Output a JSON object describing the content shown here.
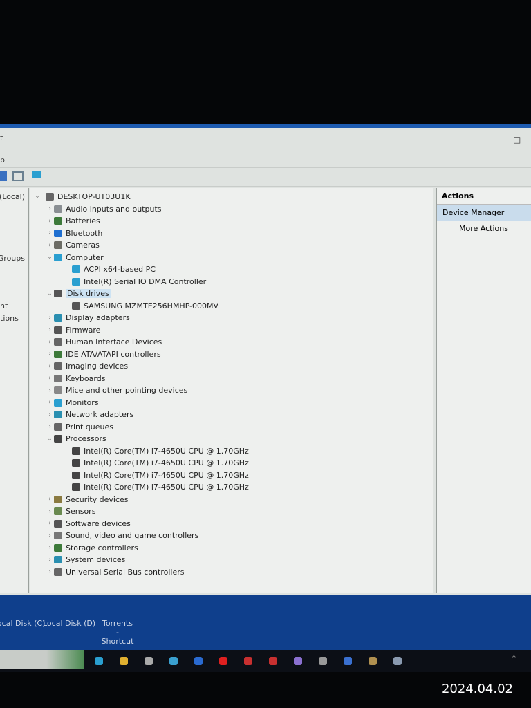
{
  "window": {
    "title_fragment": "t",
    "menu_fragment": "p",
    "max_icon": "maximize-icon",
    "min_icon": "minimize-icon"
  },
  "left_pane": [
    "(Local)",
    "Groups",
    "nt",
    "tions"
  ],
  "tree": {
    "root": "DESKTOP-UT03U1K",
    "rows": [
      {
        "label": "Audio inputs and outputs",
        "level": 1,
        "expanded": false,
        "icon": "speaker-icon",
        "color": "#8a8f93"
      },
      {
        "label": "Batteries",
        "level": 1,
        "expanded": false,
        "icon": "battery-icon",
        "color": "#3d7a3a"
      },
      {
        "label": "Bluetooth",
        "level": 1,
        "expanded": false,
        "icon": "bluetooth-icon",
        "color": "#1f6fd0"
      },
      {
        "label": "Cameras",
        "level": 1,
        "expanded": false,
        "icon": "camera-icon",
        "color": "#6d6d66"
      },
      {
        "label": "Computer",
        "level": 1,
        "expanded": true,
        "icon": "monitor-icon",
        "color": "#2a9fd0"
      },
      {
        "label": "ACPI x64-based PC",
        "level": 2,
        "icon": "monitor-icon",
        "color": "#2a9fd0"
      },
      {
        "label": "Intel(R) Serial IO DMA Controller",
        "level": 2,
        "icon": "monitor-icon",
        "color": "#2a9fd0"
      },
      {
        "label": "Disk drives",
        "level": 1,
        "expanded": true,
        "selected": true,
        "icon": "disk-icon",
        "color": "#555"
      },
      {
        "label": "SAMSUNG MZMTE256HMHP-000MV",
        "level": 2,
        "icon": "disk-icon",
        "color": "#555"
      },
      {
        "label": "Display adapters",
        "level": 1,
        "expanded": false,
        "icon": "display-icon",
        "color": "#2a8fb0"
      },
      {
        "label": "Firmware",
        "level": 1,
        "expanded": false,
        "icon": "firmware-icon",
        "color": "#555"
      },
      {
        "label": "Human Interface Devices",
        "level": 1,
        "expanded": false,
        "icon": "hid-icon",
        "color": "#666"
      },
      {
        "label": "IDE ATA/ATAPI controllers",
        "level": 1,
        "expanded": false,
        "icon": "controller-icon",
        "color": "#3d7a3a"
      },
      {
        "label": "Imaging devices",
        "level": 1,
        "expanded": false,
        "icon": "scanner-icon",
        "color": "#666"
      },
      {
        "label": "Keyboards",
        "level": 1,
        "expanded": false,
        "icon": "keyboard-icon",
        "color": "#777"
      },
      {
        "label": "Mice and other pointing devices",
        "level": 1,
        "expanded": false,
        "icon": "mouse-icon",
        "color": "#888"
      },
      {
        "label": "Monitors",
        "level": 1,
        "expanded": false,
        "icon": "monitor-icon",
        "color": "#2a9fd0"
      },
      {
        "label": "Network adapters",
        "level": 1,
        "expanded": false,
        "icon": "network-icon",
        "color": "#2a8fb0"
      },
      {
        "label": "Print queues",
        "level": 1,
        "expanded": false,
        "icon": "printer-icon",
        "color": "#666"
      },
      {
        "label": "Processors",
        "level": 1,
        "expanded": true,
        "icon": "cpu-icon",
        "color": "#444"
      },
      {
        "label": "Intel(R) Core(TM) i7-4650U CPU @ 1.70GHz",
        "level": 2,
        "icon": "cpu-icon",
        "color": "#444"
      },
      {
        "label": "Intel(R) Core(TM) i7-4650U CPU @ 1.70GHz",
        "level": 2,
        "icon": "cpu-icon",
        "color": "#444"
      },
      {
        "label": "Intel(R) Core(TM) i7-4650U CPU @ 1.70GHz",
        "level": 2,
        "icon": "cpu-icon",
        "color": "#444"
      },
      {
        "label": "Intel(R) Core(TM) i7-4650U CPU @ 1.70GHz",
        "level": 2,
        "icon": "cpu-icon",
        "color": "#444"
      },
      {
        "label": "Security devices",
        "level": 1,
        "expanded": false,
        "icon": "security-icon",
        "color": "#8a7a40"
      },
      {
        "label": "Sensors",
        "level": 1,
        "expanded": false,
        "icon": "sensor-icon",
        "color": "#6a8a50"
      },
      {
        "label": "Software devices",
        "level": 1,
        "expanded": false,
        "icon": "software-icon",
        "color": "#555"
      },
      {
        "label": "Sound, video and game controllers",
        "level": 1,
        "expanded": false,
        "icon": "sound-icon",
        "color": "#777"
      },
      {
        "label": "Storage controllers",
        "level": 1,
        "expanded": false,
        "icon": "storage-icon",
        "color": "#3d7a3a"
      },
      {
        "label": "System devices",
        "level": 1,
        "expanded": false,
        "icon": "system-icon",
        "color": "#2a8fb0"
      },
      {
        "label": "Universal Serial Bus controllers",
        "level": 1,
        "expanded": false,
        "icon": "usb-icon",
        "color": "#666"
      }
    ]
  },
  "actions": {
    "header": "Actions",
    "selected": "Device Manager",
    "more": "More Actions"
  },
  "desktop": {
    "icons": [
      "Local Disk (C)",
      "Local Disk (D)",
      "Torrents - Shortcut"
    ]
  },
  "taskbar": {
    "icons": [
      {
        "name": "edge-icon",
        "color": "#2a9fd0"
      },
      {
        "name": "file-explorer-icon",
        "color": "#e0b030"
      },
      {
        "name": "store-icon",
        "color": "#aaa"
      },
      {
        "name": "mail-icon",
        "color": "#3aa0d0"
      },
      {
        "name": "facebook-icon",
        "color": "#2a6ad0"
      },
      {
        "name": "youtube-icon",
        "color": "#e02020"
      },
      {
        "name": "app-s-icon",
        "color": "#c83030"
      },
      {
        "name": "app-s2-icon",
        "color": "#c83030"
      },
      {
        "name": "app-circle-icon",
        "color": "#8a70d0"
      },
      {
        "name": "we-icon",
        "color": "#999"
      },
      {
        "name": "app-v-icon",
        "color": "#3a70d0"
      },
      {
        "name": "app-coin-icon",
        "color": "#b09050"
      },
      {
        "name": "device-manager-icon",
        "color": "#8a9ab0"
      }
    ]
  },
  "timestamp": "2024.04.02"
}
